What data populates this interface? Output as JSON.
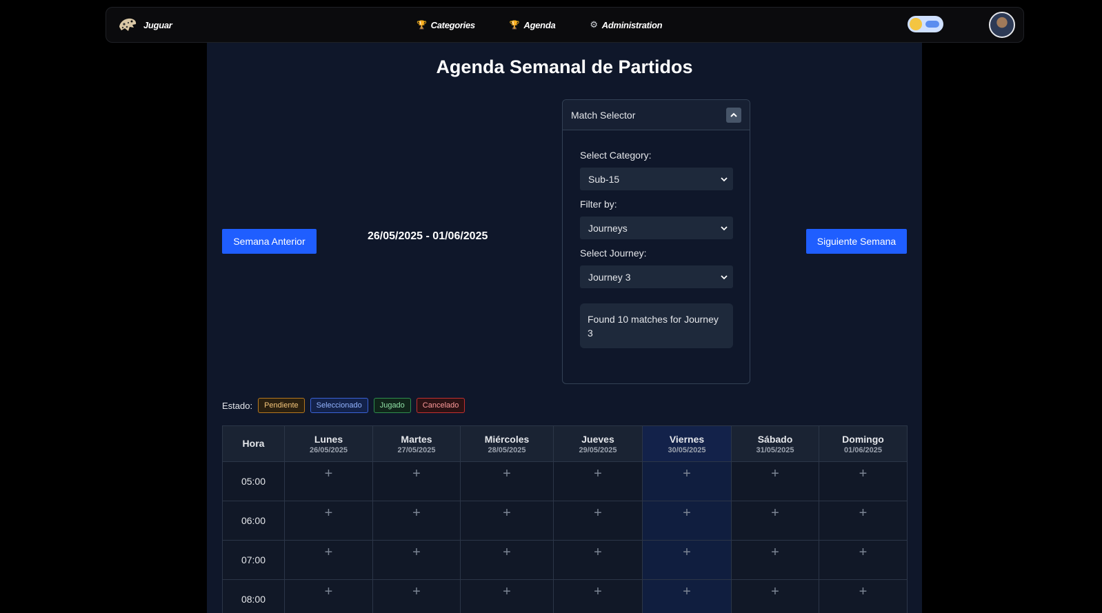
{
  "nav": {
    "brand": "Juguar",
    "links": [
      {
        "label": "Categories",
        "icon": "trophy-icon"
      },
      {
        "label": "Agenda",
        "icon": "trophy-icon"
      },
      {
        "label": "Administration",
        "icon": "gear-icon"
      }
    ]
  },
  "page": {
    "title": "Agenda Semanal de Partidos",
    "prev_button": "Semana Anterior",
    "next_button": "Siguiente Semana",
    "week_range": "26/05/2025 - 01/06/2025"
  },
  "selector": {
    "title": "Match Selector",
    "category_label": "Select Category:",
    "category_value": "Sub-15",
    "filter_label": "Filter by:",
    "filter_value": "Journeys",
    "journey_label": "Select Journey:",
    "journey_value": "Journey 3",
    "found_text": "Found 10 matches for Journey 3"
  },
  "legend": {
    "label": "Estado:",
    "items": [
      "Pendiente",
      "Seleccionado",
      "Jugado",
      "Cancelado"
    ],
    "colors": {
      "pendiente": "#b7791f",
      "seleccionado": "#3b63d9",
      "jugado": "#2f8f4e",
      "cancelado": "#c53030"
    }
  },
  "calendar": {
    "hour_header": "Hora",
    "days": [
      {
        "name": "Lunes",
        "date": "26/05/2025"
      },
      {
        "name": "Martes",
        "date": "27/05/2025"
      },
      {
        "name": "Miércoles",
        "date": "28/05/2025"
      },
      {
        "name": "Jueves",
        "date": "29/05/2025"
      },
      {
        "name": "Viernes",
        "date": "30/05/2025",
        "today": true
      },
      {
        "name": "Sábado",
        "date": "31/05/2025"
      },
      {
        "name": "Domingo",
        "date": "01/06/2025"
      }
    ],
    "hours": [
      "05:00",
      "06:00",
      "07:00",
      "08:00"
    ],
    "add_symbol": "+"
  },
  "colors": {
    "accent": "#1f5eff",
    "panel": "#0f172a",
    "today_column": "#13224a"
  }
}
